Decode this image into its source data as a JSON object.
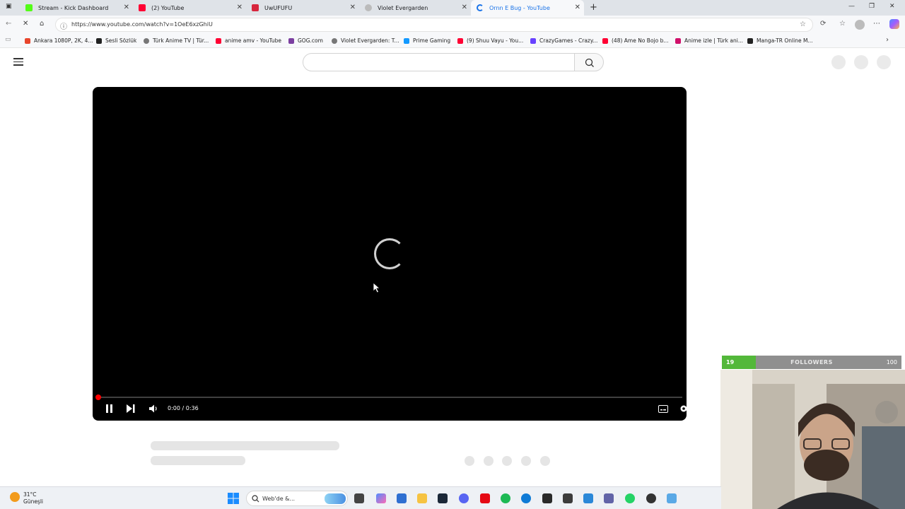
{
  "browser": {
    "tabs": [
      {
        "label": "Stream - Kick Dashboard",
        "color": "#53fc18"
      },
      {
        "label": "(2) YouTube",
        "color": "#ff0033"
      },
      {
        "label": "UwUFUFU",
        "color": "#d7263d"
      },
      {
        "label": "Violet Evergarden",
        "color": "#888888"
      },
      {
        "label": "Ornn E Bug - YouTube",
        "color": "#1a73e8"
      }
    ],
    "new_tab_glyph": "+",
    "close_glyph": "✕",
    "url": "https://www.youtube.com/watch?v=1OeE6xzGhiU",
    "bookmarks": [
      {
        "label": "Ankara 1080P, 2K, 4...",
        "color": "#e8452c"
      },
      {
        "label": "Sesli Sözlük",
        "color": "#222222"
      },
      {
        "label": "Türk Anime TV | Tür...",
        "color": "#777777"
      },
      {
        "label": "anime amv - YouTube",
        "color": "#ff0033"
      },
      {
        "label": "GOG.com",
        "color": "#7b3fa0"
      },
      {
        "label": "Violet Evergarden: T...",
        "color": "#777777"
      },
      {
        "label": "Prime Gaming",
        "color": "#1399ff"
      },
      {
        "label": "(9) Shuu Vayu - You...",
        "color": "#ff0033"
      },
      {
        "label": "CrazyGames - Crazy...",
        "color": "#6842ff"
      },
      {
        "label": "(48) Ame No Bojo b...",
        "color": "#ff0033"
      },
      {
        "label": "Anime izle | Türk ani...",
        "color": "#d0106a"
      },
      {
        "label": "Manga-TR Online M...",
        "color": "#222222"
      }
    ]
  },
  "player": {
    "time": "0:00 / 0:36",
    "progress_fraction": 0.0
  },
  "overlay": {
    "followers_now": "19",
    "followers_label": "FOLLOWERS",
    "followers_goal": "100",
    "followers_fraction": 0.19,
    "fill_color": "#53b83a"
  },
  "taskbar": {
    "temperature": "31°C",
    "condition": "Güneşli",
    "search_placeholder": "Web'de &..."
  }
}
